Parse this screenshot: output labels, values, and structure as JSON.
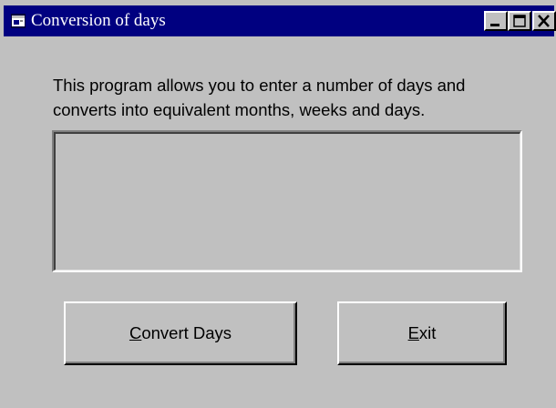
{
  "window": {
    "title": "Conversion of days",
    "controls": {
      "minimize_icon": "minimize-icon",
      "maximize_icon": "maximize-icon",
      "close_icon": "close-icon"
    }
  },
  "description": {
    "line1": "This program allows you to enter a number of days and",
    "line2": "converts into equivalent months, weeks and days."
  },
  "output": {
    "text": ""
  },
  "buttons": {
    "convert": {
      "mnemonic": "C",
      "rest": "onvert Days"
    },
    "exit": {
      "mnemonic": "E",
      "rest": "xit"
    }
  },
  "colors": {
    "titlebar": "#000080",
    "face": "#c0c0c0",
    "title_text": "#ffffff"
  }
}
